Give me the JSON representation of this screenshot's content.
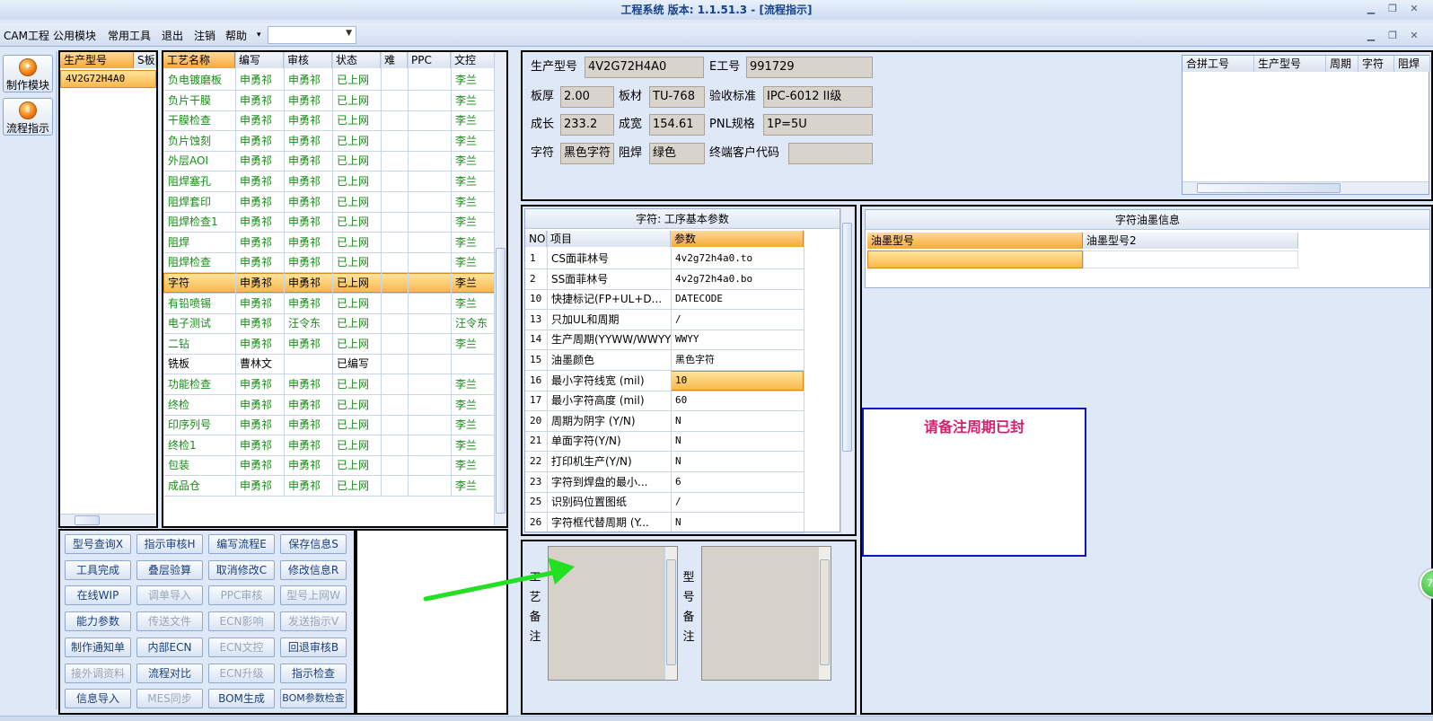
{
  "window": {
    "title": "工程系统  版本: 1.1.51.3 - [流程指示]",
    "min_icon": "minimize-icon",
    "restore_icon": "restore-icon",
    "close_icon": "close-icon"
  },
  "menubar": {
    "items": [
      "CAM工程",
      "公用模块",
      "常用工具",
      "退出",
      "注销",
      "帮助"
    ],
    "dropdown_arrow": "▾",
    "combo_value": ""
  },
  "nav": {
    "items": [
      {
        "label": "制作模块",
        "icon": "flame-icon"
      },
      {
        "label": "流程指示",
        "icon": "flow-icon"
      }
    ]
  },
  "model_list": {
    "headers": [
      "生产型号",
      "S板"
    ],
    "rows": [
      "4V2G72H4A0"
    ]
  },
  "process_table": {
    "headers": [
      "工艺名称",
      "编写",
      "审核",
      "状态",
      "难",
      "PPC",
      "文控"
    ],
    "rows": [
      [
        "负电镀磨板",
        "申勇祁",
        "申勇祁",
        "已上网",
        "",
        "",
        "李兰"
      ],
      [
        "负片干膜",
        "申勇祁",
        "申勇祁",
        "已上网",
        "",
        "",
        "李兰"
      ],
      [
        "干膜检查",
        "申勇祁",
        "申勇祁",
        "已上网",
        "",
        "",
        "李兰"
      ],
      [
        "负片蚀刻",
        "申勇祁",
        "申勇祁",
        "已上网",
        "",
        "",
        "李兰"
      ],
      [
        "外层AOI",
        "申勇祁",
        "申勇祁",
        "已上网",
        "",
        "",
        "李兰"
      ],
      [
        "阻焊塞孔",
        "申勇祁",
        "申勇祁",
        "已上网",
        "",
        "",
        "李兰"
      ],
      [
        "阻焊套印",
        "申勇祁",
        "申勇祁",
        "已上网",
        "",
        "",
        "李兰"
      ],
      [
        "阻焊检查1",
        "申勇祁",
        "申勇祁",
        "已上网",
        "",
        "",
        "李兰"
      ],
      [
        "阻焊",
        "申勇祁",
        "申勇祁",
        "已上网",
        "",
        "",
        "李兰"
      ],
      [
        "阻焊检查",
        "申勇祁",
        "申勇祁",
        "已上网",
        "",
        "",
        "李兰"
      ],
      [
        "字符",
        "申勇祁",
        "申勇祁",
        "已上网",
        "",
        "",
        "李兰"
      ],
      [
        "有铅喷锡",
        "申勇祁",
        "申勇祁",
        "已上网",
        "",
        "",
        "李兰"
      ],
      [
        "电子测试",
        "申勇祁",
        "汪令东",
        "已上网",
        "",
        "",
        "汪令东"
      ],
      [
        "二钻",
        "申勇祁",
        "申勇祁",
        "已上网",
        "",
        "",
        "李兰"
      ],
      [
        "铣板",
        "曹林文",
        "",
        "已编写",
        "",
        "",
        ""
      ],
      [
        "功能检查",
        "申勇祁",
        "申勇祁",
        "已上网",
        "",
        "",
        "李兰"
      ],
      [
        "终检",
        "申勇祁",
        "申勇祁",
        "已上网",
        "",
        "",
        "李兰"
      ],
      [
        "印序列号",
        "申勇祁",
        "申勇祁",
        "已上网",
        "",
        "",
        "李兰"
      ],
      [
        "终检1",
        "申勇祁",
        "申勇祁",
        "已上网",
        "",
        "",
        "李兰"
      ],
      [
        "包装",
        "申勇祁",
        "申勇祁",
        "已上网",
        "",
        "",
        "李兰"
      ],
      [
        "成品仓",
        "申勇祁",
        "申勇祁",
        "已上网",
        "",
        "",
        "李兰"
      ]
    ],
    "selected_index": 10
  },
  "actions": [
    [
      {
        "label": "型号查询X",
        "on": true
      },
      {
        "label": "指示审核H",
        "on": true
      },
      {
        "label": "编写流程E",
        "on": true
      },
      {
        "label": "保存信息S",
        "on": true
      }
    ],
    [
      {
        "label": "工具完成",
        "on": true
      },
      {
        "label": "叠层验算",
        "on": true
      },
      {
        "label": "取消修改C",
        "on": true
      },
      {
        "label": "修改信息R",
        "on": true
      }
    ],
    [
      {
        "label": "在线WIP",
        "on": true
      },
      {
        "label": "调单导入",
        "on": false
      },
      {
        "label": "PPC审核",
        "on": false
      },
      {
        "label": "型号上网W",
        "on": false
      }
    ],
    [
      {
        "label": "能力参数",
        "on": true
      },
      {
        "label": "传送文件",
        "on": false
      },
      {
        "label": "ECN影响",
        "on": false
      },
      {
        "label": "发送指示V",
        "on": false
      }
    ],
    [
      {
        "label": "制作通知单",
        "on": true
      },
      {
        "label": "内部ECN",
        "on": true
      },
      {
        "label": "ECN文控",
        "on": false
      },
      {
        "label": "回退审核B",
        "on": true
      }
    ],
    [
      {
        "label": "接外调资料",
        "on": false
      },
      {
        "label": "流程对比",
        "on": true
      },
      {
        "label": "ECN升级",
        "on": false
      },
      {
        "label": "指示检查",
        "on": true
      }
    ],
    [
      {
        "label": "信息导入",
        "on": true
      },
      {
        "label": "MES同步",
        "on": false
      },
      {
        "label": "BOM生成",
        "on": true
      },
      {
        "label": "BOM参数检查",
        "on": true
      }
    ]
  ],
  "info": {
    "model_label": "生产型号",
    "model": "4V2G72H4A0",
    "e_label": "E工号",
    "e_no": "991729",
    "thick_label": "板厚",
    "thick": "2.00",
    "mat_label": "板材",
    "mat": "TU-768",
    "std_label": "验收标准",
    "std": "IPC-6012 II级",
    "len_label": "成长",
    "len": "233.2",
    "wid_label": "成宽",
    "wid": "154.61",
    "pnl_label": "PNL规格",
    "pnl": "1P=5U",
    "char_label": "字符",
    "char": "黑色字符",
    "mask_label": "阻焊",
    "mask": "绿色",
    "cust_label": "终端客户代码",
    "cust": ""
  },
  "combo_table": {
    "headers": [
      "合拼工号",
      "生产型号",
      "周期",
      "字符",
      "阻焊"
    ]
  },
  "params": {
    "title": "字符: 工序基本参数",
    "headers": [
      "NO",
      "项目",
      "参数"
    ],
    "rows": [
      [
        "1",
        "CS面菲林号",
        "4v2g72h4a0.to"
      ],
      [
        "2",
        "SS面菲林号",
        "4v2g72h4a0.bo"
      ],
      [
        "10",
        "快捷标记(FP+UL+D...",
        "DATECODE"
      ],
      [
        "13",
        "只加UL和周期",
        "/"
      ],
      [
        "14",
        "生产周期(YYWW/WWYY)",
        "WWYY"
      ],
      [
        "15",
        "油墨颜色",
        "黑色字符"
      ],
      [
        "16",
        "最小字符线宽 (mil)",
        "10"
      ],
      [
        "17",
        "最小字符高度 (mil)",
        "60"
      ],
      [
        "20",
        "周期为阴字 (Y/N)",
        "N"
      ],
      [
        "21",
        "单面字符(Y/N)",
        "N"
      ],
      [
        "22",
        "打印机生产(Y/N)",
        "N"
      ],
      [
        "23",
        "字符到焊盘的最小...",
        "6"
      ],
      [
        "25",
        "识别码位置图纸",
        "/"
      ],
      [
        "26",
        "字符框代替周期 (Y...",
        "N"
      ]
    ],
    "selected_index": 6
  },
  "ink": {
    "title": "字符油墨信息",
    "headers": [
      "油墨型号",
      "油墨型号2"
    ]
  },
  "notes": {
    "process_label": "工艺备注",
    "model_label": "型号备注"
  },
  "annotation": {
    "text": "请备注周期已封",
    "badge": "72"
  }
}
